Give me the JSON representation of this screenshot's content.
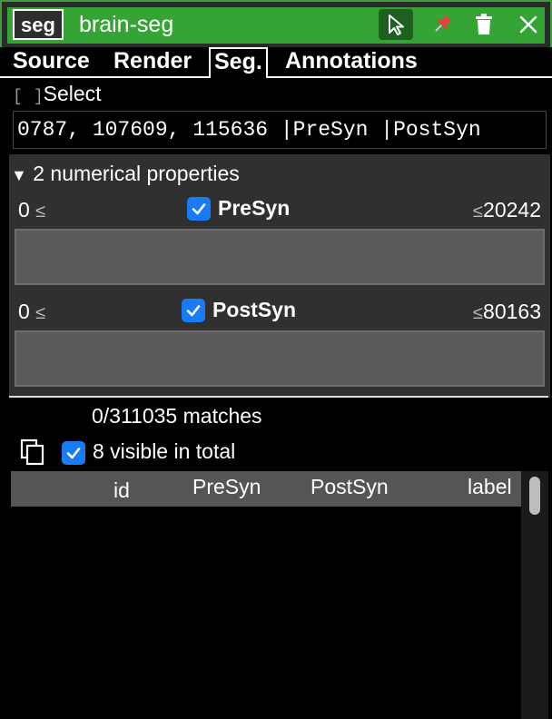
{
  "window": {
    "layer_type": "seg",
    "layer_name": "brain-seg"
  },
  "tabs": [
    {
      "label": "Source"
    },
    {
      "label": "Render"
    },
    {
      "label": "Seg.",
      "selected": true
    },
    {
      "label": "Annotations"
    }
  ],
  "select": {
    "bracket_open": "[",
    "bracket_close": "]",
    "label": "Select"
  },
  "query": {
    "value": "0787, 107609, 115636 |PreSyn |PostSyn"
  },
  "properties": {
    "header": "2 numerical properties",
    "items": [
      {
        "min": "0",
        "label": "PreSyn",
        "max": "20242",
        "checked": true
      },
      {
        "min": "0",
        "label": "PostSyn",
        "max": "80163",
        "checked": true
      }
    ]
  },
  "results": {
    "matches": "0/311035 matches",
    "visible": "8 visible in total",
    "visible_checked": true
  },
  "table": {
    "columns": [
      "id",
      "PreSyn",
      "PostSyn",
      "label"
    ]
  },
  "colors": {
    "accent_green": "#34a534",
    "checkbox_blue": "#1a7cf5",
    "pin_red": "#e0443a"
  }
}
